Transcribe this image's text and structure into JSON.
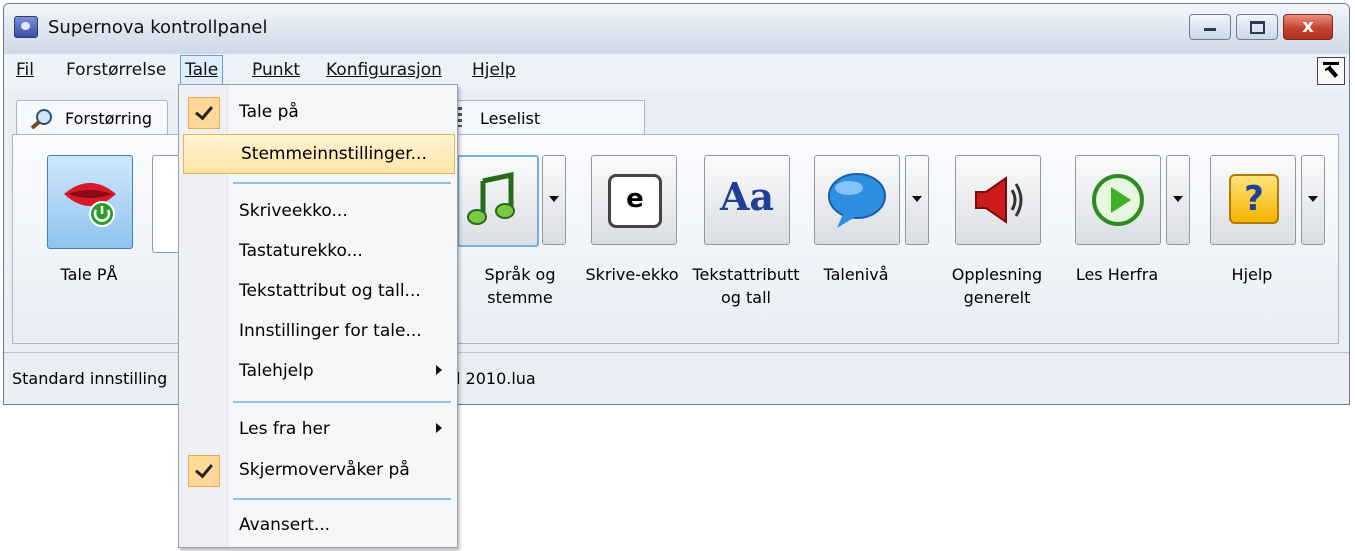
{
  "window": {
    "title": "Supernova kontrollpanel",
    "close_glyph": "x"
  },
  "menubar": {
    "fil": "Fil",
    "forstorrelse": "Forstørrelse",
    "tale": "Tale",
    "punkt": "Punkt",
    "konfigurasjon": "Konfigurasjon",
    "hjelp": "Hjelp"
  },
  "tabs": {
    "forstorring": "Forstørring",
    "leselist": "Leselist"
  },
  "toolbar": {
    "tale_pa": "Tale PÅ",
    "sprak_line1": "Språk og",
    "sprak_line2": "stemme",
    "skrive_ekko": "Skrive-ekko",
    "tekst_line1": "Tekstattributt",
    "tekst_line2": "og tall",
    "talenivaa": "Talenivå",
    "opplesning_line1": "Opplesning",
    "opplesning_line2": "generelt",
    "les_herfra": "Les Herfra",
    "hjelp": "Hjelp",
    "skrive_icon_text": "e",
    "tekst_icon_text": "Aa",
    "hjelp_icon_text": "?"
  },
  "statusbar": {
    "left": "Standard innstilling",
    "right": "l 2010.lua"
  },
  "tale_menu": {
    "items": [
      {
        "label": "Tale på",
        "checked": true
      },
      {
        "label": "Stemmeinnstillinger...",
        "highlighted": true
      },
      {
        "label": "Skriveekko..."
      },
      {
        "label": "Tastaturekko..."
      },
      {
        "label": "Tekstattribut og tall..."
      },
      {
        "label": "Innstillinger for tale..."
      },
      {
        "label": "Talehjelp",
        "submenu": true
      },
      {
        "label": "Les fra her",
        "submenu": true
      },
      {
        "label": "Skjermovervåker på",
        "checked": true
      },
      {
        "label": "Avansert..."
      }
    ]
  },
  "colors": {
    "accent_blue": "#3d7fc0",
    "menu_highlight": "#ffe3a3",
    "check_bg": "#ffd997",
    "close_red": "#c44330"
  }
}
